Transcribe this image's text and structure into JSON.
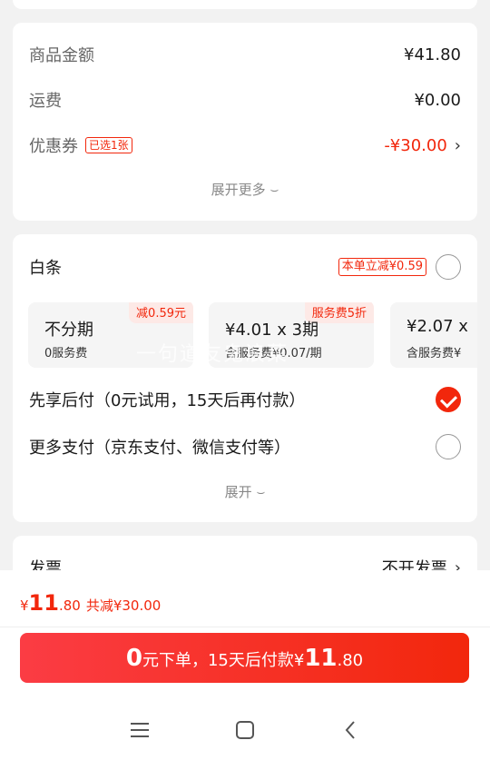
{
  "price_card": {
    "goods_amount_label": "商品金额",
    "goods_amount_value": "¥41.80",
    "shipping_label": "运费",
    "shipping_value": "¥0.00",
    "coupon_label": "优惠券",
    "coupon_tag": "已选1张",
    "coupon_value": "-¥30.00",
    "expand_more": "展开更多 ⌣"
  },
  "payment_card": {
    "baitiao_label": "白条",
    "baitiao_promo": "本单立减¥0.59",
    "plans": [
      {
        "badge": "减0.59元",
        "title": "不分期",
        "sub": "0服务费"
      },
      {
        "badge": "服务费5折",
        "title": "¥4.01 x 3期",
        "sub": "含服务费¥0.07/期"
      },
      {
        "badge": "",
        "title": "¥2.07 x",
        "sub": "含服务费¥"
      }
    ],
    "pay_later_label": "先享后付（0元试用，15天后再付款）",
    "more_pay_label": "更多支付（京东支付、微信支付等）",
    "expand": "展开 ⌣"
  },
  "invoice_card": {
    "label": "发票",
    "value": "不开发票"
  },
  "watermark": "一句道友鬼浪菜",
  "bottom_bar": {
    "total_symbol": "¥",
    "total_int": "11",
    "total_dec": ".80",
    "total_saved": "共减¥30.00",
    "submit_big_zero": "0",
    "submit_text_1": "元下单，15天后付款¥",
    "submit_big_amount": "11",
    "submit_dec": ".80"
  },
  "colors": {
    "accent": "#f2270c",
    "background": "#f2f2f2"
  },
  "icons": [
    "chevron-right-icon",
    "radio-checked-icon",
    "radio-empty-icon",
    "menu-icon",
    "home-icon",
    "back-icon"
  ]
}
